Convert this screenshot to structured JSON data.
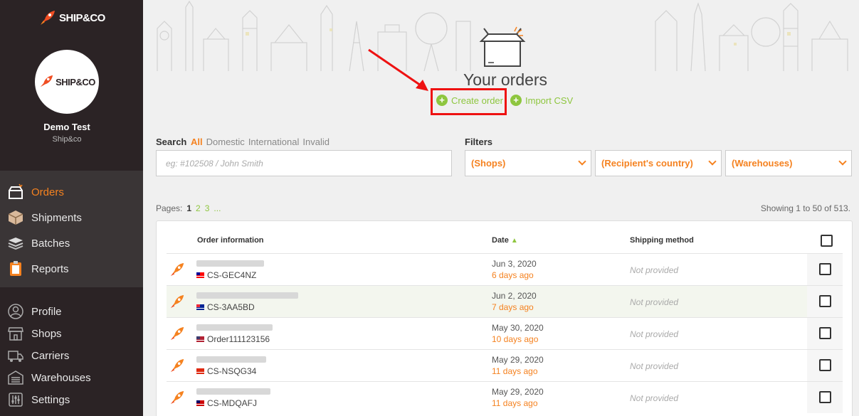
{
  "app": {
    "logo_text": "SHIP&CO"
  },
  "user": {
    "name": "Demo Test",
    "org": "Ship&co"
  },
  "nav": {
    "main": [
      {
        "label": "Orders",
        "icon": "box-icon",
        "active": true
      },
      {
        "label": "Shipments",
        "icon": "package-icon"
      },
      {
        "label": "Batches",
        "icon": "stack-icon"
      },
      {
        "label": "Reports",
        "icon": "clipboard-icon"
      }
    ],
    "secondary": [
      {
        "label": "Profile",
        "icon": "person-icon"
      },
      {
        "label": "Shops",
        "icon": "store-icon"
      },
      {
        "label": "Carriers",
        "icon": "truck-icon"
      },
      {
        "label": "Warehouses",
        "icon": "warehouse-icon"
      },
      {
        "label": "Settings",
        "icon": "gear-icon"
      }
    ]
  },
  "header": {
    "title": "Your orders",
    "create_label": "Create order",
    "import_label": "Import CSV"
  },
  "search": {
    "label": "Search",
    "tabs": [
      "All",
      "Domestic",
      "International",
      "Invalid"
    ],
    "placeholder": "eg: #102508 / John Smith"
  },
  "filters": {
    "label": "Filters",
    "shops": "(Shops)",
    "country": "(Recipient's country)",
    "warehouses": "(Warehouses)"
  },
  "pagination": {
    "label": "Pages:",
    "current": "1",
    "pages": [
      "2",
      "3",
      "..."
    ],
    "showing": "Showing 1 to 50 of 513."
  },
  "table": {
    "columns": {
      "order": "Order information",
      "date": "Date",
      "shipping": "Shipping method"
    },
    "rows": [
      {
        "id": "CS-GEC4NZ",
        "flag": "tw",
        "date": "Jun 3, 2020",
        "ago": "6 days ago",
        "shipping": "Not provided"
      },
      {
        "id": "CS-3AA5BD",
        "flag": "fr",
        "date": "Jun 2, 2020",
        "ago": "7 days ago",
        "shipping": "Not provided"
      },
      {
        "id": "Order111123156",
        "flag": "us",
        "date": "May 30, 2020",
        "ago": "10 days ago",
        "shipping": "Not provided"
      },
      {
        "id": "CS-NSQG34",
        "flag": "hk",
        "date": "May 29, 2020",
        "ago": "11 days ago",
        "shipping": "Not provided"
      },
      {
        "id": "CS-MDQAFJ",
        "flag": "my",
        "date": "May 29, 2020",
        "ago": "11 days ago",
        "shipping": "Not provided"
      }
    ]
  },
  "colors": {
    "accent": "#f58220",
    "green": "#8ec63f",
    "sidebar": "#2b2325",
    "highlight": "#ee1111"
  }
}
